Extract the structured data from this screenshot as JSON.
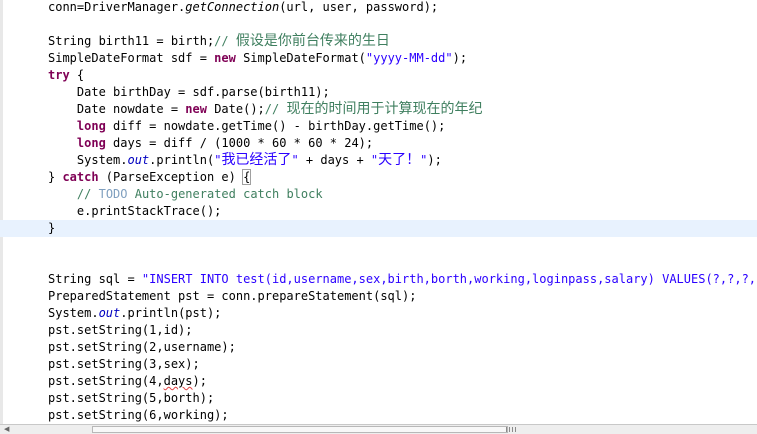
{
  "editor": {
    "lines": [
      {
        "segments": [
          {
            "t": "conn=DriverManager."
          },
          {
            "t": "getConnection",
            "c": "it"
          },
          {
            "t": "(url, user, password);"
          }
        ]
      },
      {
        "segments": []
      },
      {
        "segments": [
          {
            "t": "String birth11 = birth;"
          },
          {
            "t": "// ",
            "c": "cm"
          },
          {
            "t": "假设是你前台传来的生日",
            "c": "cm cjk"
          }
        ]
      },
      {
        "segments": [
          {
            "t": "SimpleDateFormat sdf = "
          },
          {
            "t": "new",
            "c": "kw"
          },
          {
            "t": " SimpleDateFormat("
          },
          {
            "t": "\"yyyy-MM-dd\"",
            "c": "str"
          },
          {
            "t": ");"
          }
        ]
      },
      {
        "segments": [
          {
            "t": "try",
            "c": "kw"
          },
          {
            "t": " {"
          }
        ]
      },
      {
        "segments": [
          {
            "t": "    Date birthDay = sdf.parse(birth11);"
          }
        ]
      },
      {
        "segments": [
          {
            "t": "    Date nowdate = "
          },
          {
            "t": "new",
            "c": "kw"
          },
          {
            "t": " Date();"
          },
          {
            "t": "// ",
            "c": "cm"
          },
          {
            "t": "现在的时间用于计算现在的年纪",
            "c": "cm cjk"
          }
        ]
      },
      {
        "segments": [
          {
            "t": "    "
          },
          {
            "t": "long",
            "c": "kw"
          },
          {
            "t": " diff = nowdate.getTime() - birthDay.getTime();"
          }
        ]
      },
      {
        "segments": [
          {
            "t": "    "
          },
          {
            "t": "long",
            "c": "kw"
          },
          {
            "t": " days = diff / (1000 * 60 * 60 * 24);"
          }
        ]
      },
      {
        "segments": [
          {
            "t": "    System."
          },
          {
            "t": "out",
            "c": "fld"
          },
          {
            "t": ".println("
          },
          {
            "t": "\"",
            "c": "str"
          },
          {
            "t": "我已经活了",
            "c": "str cjk"
          },
          {
            "t": "\"",
            "c": "str"
          },
          {
            "t": " + days + "
          },
          {
            "t": "\"",
            "c": "str"
          },
          {
            "t": "天了！",
            "c": "str cjk"
          },
          {
            "t": "\"",
            "c": "str"
          },
          {
            "t": ");"
          }
        ]
      },
      {
        "segments": [
          {
            "t": "} "
          },
          {
            "t": "catch",
            "c": "kw"
          },
          {
            "t": " (ParseException e) "
          },
          {
            "t": "{",
            "c": "bracket"
          }
        ]
      },
      {
        "segments": [
          {
            "t": "    "
          },
          {
            "t": "// ",
            "c": "cm"
          },
          {
            "t": "TODO",
            "c": "jd"
          },
          {
            "t": " Auto-generated catch block",
            "c": "cm"
          }
        ]
      },
      {
        "segments": [
          {
            "t": "    e.printStackTrace();"
          }
        ]
      },
      {
        "segments": [
          {
            "t": "}"
          }
        ],
        "highlight": true
      },
      {
        "segments": []
      },
      {
        "segments": []
      },
      {
        "segments": [
          {
            "t": "String sql = "
          },
          {
            "t": "\"INSERT INTO test(id,username,sex,birth,borth,working,loginpass,salary) VALUES(?,?,?,?,?,?,?,?)\"",
            "c": "str"
          },
          {
            "t": ";"
          }
        ]
      },
      {
        "segments": [
          {
            "t": "PreparedStatement pst = conn.prepareStatement(sql);"
          }
        ]
      },
      {
        "segments": [
          {
            "t": "System."
          },
          {
            "t": "out",
            "c": "fld"
          },
          {
            "t": ".println(pst);"
          }
        ]
      },
      {
        "segments": [
          {
            "t": "pst.setString(1,id);"
          }
        ]
      },
      {
        "segments": [
          {
            "t": "pst.setString(2,username);"
          }
        ]
      },
      {
        "segments": [
          {
            "t": "pst.setString(3,sex);"
          }
        ]
      },
      {
        "segments": [
          {
            "t": "pst.setString(4,"
          },
          {
            "t": "days",
            "c": "warn"
          },
          {
            "t": ");"
          }
        ]
      },
      {
        "segments": [
          {
            "t": "pst.setString(5,borth);"
          }
        ]
      },
      {
        "segments": [
          {
            "t": "pst.setString(6,working);"
          }
        ]
      }
    ]
  },
  "scrollbar": {
    "left_arrow_icon": "chevron-left-icon"
  }
}
